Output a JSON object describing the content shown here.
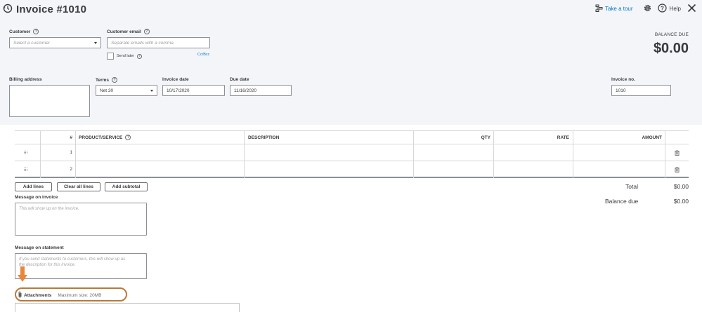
{
  "header": {
    "title": "Invoice #1010",
    "take_tour": "Take a tour",
    "help": "Help"
  },
  "customer": {
    "label": "Customer",
    "placeholder": "Select a customer"
  },
  "email": {
    "label": "Customer email",
    "placeholder": "Separate emails with a comma",
    "send_later": "Send later",
    "ccbcc": "Cc/Bcc"
  },
  "balance": {
    "label": "BALANCE DUE",
    "value": "$0.00"
  },
  "billing": {
    "label": "Billing address"
  },
  "terms": {
    "label": "Terms",
    "value": "Net 30"
  },
  "invoice_date": {
    "label": "Invoice date",
    "value": "10/17/2020"
  },
  "due_date": {
    "label": "Due date",
    "value": "11/16/2020"
  },
  "invoice_no": {
    "label": "Invoice no.",
    "value": "1010"
  },
  "table": {
    "headers": {
      "num": "#",
      "product": "PRODUCT/SERVICE",
      "description": "DESCRIPTION",
      "qty": "QTY",
      "rate": "RATE",
      "amount": "AMOUNT"
    },
    "rows": [
      "1",
      "2"
    ]
  },
  "buttons": {
    "add_lines": "Add lines",
    "clear_all": "Clear all lines",
    "add_subtotal": "Add subtotal"
  },
  "totals": {
    "total_label": "Total",
    "total_value": "$0.00",
    "balance_due_label": "Balance due",
    "balance_due_value": "$0.00"
  },
  "message_invoice": {
    "label": "Message on invoice",
    "placeholder": "This will show up on the invoice."
  },
  "message_statement": {
    "label": "Message on statement",
    "placeholder_line1": "If you send statements to customers, this will show up as",
    "placeholder_line2": "the description for this invoice."
  },
  "attachments": {
    "label": "Attachments",
    "max_size": "Maximum size: 20MB"
  },
  "colors": {
    "accent": "#0077c5",
    "header_bg": "#f4f5f8",
    "highlight": "#b87a3a",
    "arrow": "#e8873a"
  }
}
